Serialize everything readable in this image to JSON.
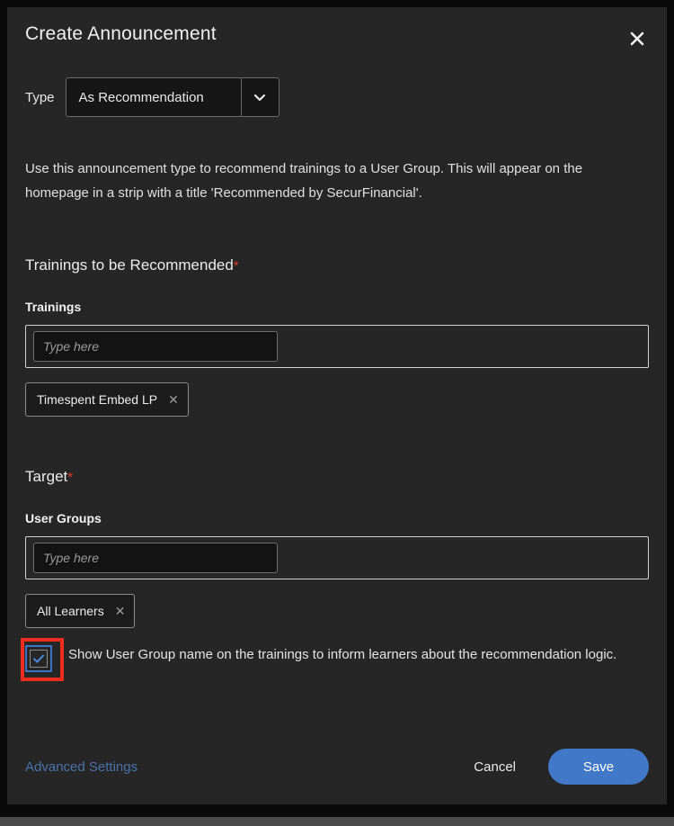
{
  "dialog": {
    "title": "Create Announcement",
    "close_icon": "close-icon"
  },
  "type_field": {
    "label": "Type",
    "selected": "As Recommendation",
    "chevron_icon": "chevron-down-icon"
  },
  "description": "Use this announcement type to recommend trainings to a User Group. This will appear on the homepage in a strip with a title 'Recommended by SecurFinancial'.",
  "trainings_section": {
    "heading": "Trainings to be Recommended",
    "required_marker": "*",
    "field_label": "Trainings",
    "input_placeholder": "Type here",
    "input_value": "",
    "chips": [
      {
        "label": "Timespent Embed LP",
        "remove_icon": "close-icon"
      }
    ]
  },
  "target_section": {
    "heading": "Target",
    "required_marker": "*",
    "field_label": "User Groups",
    "input_placeholder": "Type here",
    "input_value": "",
    "chips": [
      {
        "label": "All Learners",
        "remove_icon": "close-icon"
      }
    ]
  },
  "checkbox_option": {
    "checked": true,
    "label": "Show User Group name on the trainings to inform learners about the recommendation logic.",
    "check_icon": "checkmark-icon",
    "annotation_color": "#ef2d1f",
    "focus_color": "#3b74c4"
  },
  "footer": {
    "advanced_settings_label": "Advanced Settings",
    "cancel_label": "Cancel",
    "save_label": "Save",
    "link_color": "#4a73ad",
    "save_color": "#4178c8"
  }
}
